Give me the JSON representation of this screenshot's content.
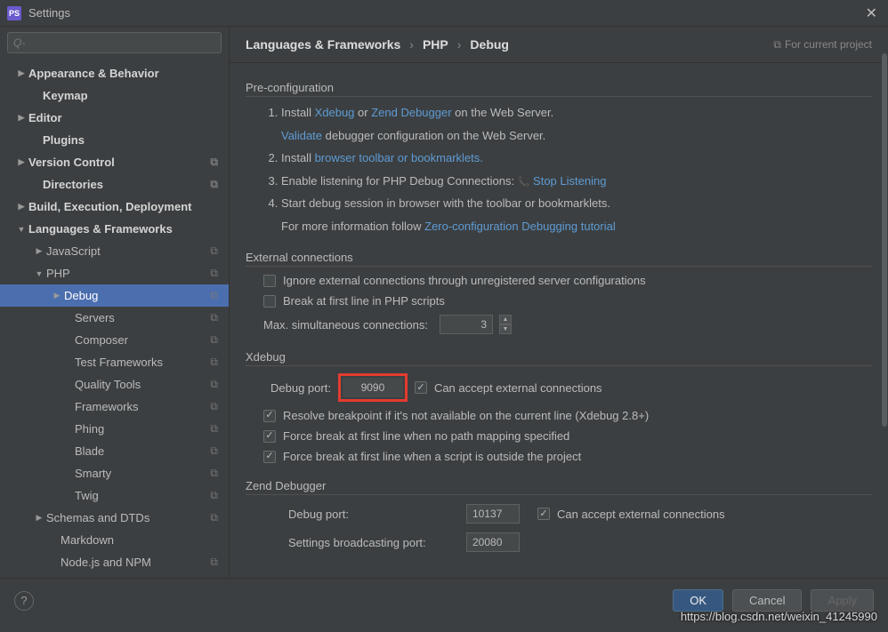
{
  "window": {
    "title": "Settings"
  },
  "search": {
    "placeholder": "Q-"
  },
  "tree": [
    {
      "label": "Appearance & Behavior",
      "bold": true,
      "arrow": "▶",
      "indent": 18
    },
    {
      "label": "Keymap",
      "bold": true,
      "indent": 34
    },
    {
      "label": "Editor",
      "bold": true,
      "arrow": "▶",
      "indent": 18
    },
    {
      "label": "Plugins",
      "bold": true,
      "indent": 34
    },
    {
      "label": "Version Control",
      "bold": true,
      "arrow": "▶",
      "indent": 18,
      "copy": true
    },
    {
      "label": "Directories",
      "bold": true,
      "indent": 34,
      "copy": true
    },
    {
      "label": "Build, Execution, Deployment",
      "bold": true,
      "arrow": "▶",
      "indent": 18
    },
    {
      "label": "Languages & Frameworks",
      "bold": true,
      "arrow": "▼",
      "indent": 18
    },
    {
      "label": "JavaScript",
      "arrow": "▶",
      "indent": 38,
      "copy": true
    },
    {
      "label": "PHP",
      "arrow": "▼",
      "indent": 38,
      "copy": true
    },
    {
      "label": "Debug",
      "arrow": "▶",
      "indent": 58,
      "copy": true,
      "selected": true
    },
    {
      "label": "Servers",
      "indent": 70,
      "copy": true
    },
    {
      "label": "Composer",
      "indent": 70,
      "copy": true
    },
    {
      "label": "Test Frameworks",
      "indent": 70,
      "copy": true
    },
    {
      "label": "Quality Tools",
      "indent": 70,
      "copy": true
    },
    {
      "label": "Frameworks",
      "indent": 70,
      "copy": true
    },
    {
      "label": "Phing",
      "indent": 70,
      "copy": true
    },
    {
      "label": "Blade",
      "indent": 70,
      "copy": true
    },
    {
      "label": "Smarty",
      "indent": 70,
      "copy": true
    },
    {
      "label": "Twig",
      "indent": 70,
      "copy": true
    },
    {
      "label": "Schemas and DTDs",
      "arrow": "▶",
      "indent": 38,
      "copy": true
    },
    {
      "label": "Markdown",
      "indent": 54
    },
    {
      "label": "Node.js and NPM",
      "indent": 54,
      "copy": true
    }
  ],
  "breadcrumb": {
    "a": "Languages & Frameworks",
    "b": "PHP",
    "c": "Debug",
    "proj": "For current project"
  },
  "preconfig": {
    "title": "Pre-configuration",
    "step1a": "Install ",
    "xdebug": "Xdebug",
    "or": " or ",
    "zend": "Zend Debugger",
    "step1b": " on the Web Server.",
    "validate": "Validate",
    "validateb": " debugger configuration on the Web Server.",
    "step2a": "Install ",
    "bookmarklets": "browser toolbar or bookmarklets.",
    "step3a": "Enable listening for PHP Debug Connections: ",
    "stop": "Stop Listening",
    "step4a": "Start debug session in browser with the toolbar or bookmarklets.",
    "step4b": "For more information follow ",
    "tutorial": "Zero-configuration Debugging tutorial"
  },
  "external": {
    "title": "External connections",
    "ignore": "Ignore external connections through unregistered server configurations",
    "break": "Break at first line in PHP scripts",
    "maxlabel": "Max. simultaneous connections:",
    "max": "3"
  },
  "xdebug": {
    "title": "Xdebug",
    "portlabel": "Debug port:",
    "port": "9090",
    "accept": "Can accept external connections",
    "resolve": "Resolve breakpoint if it's not available on the current line (Xdebug 2.8+)",
    "force1": "Force break at first line when no path mapping specified",
    "force2": "Force break at first line when a script is outside the project"
  },
  "zendd": {
    "title": "Zend Debugger",
    "portlabel": "Debug port:",
    "port": "10137",
    "accept": "Can accept external connections",
    "bcastlabel": "Settings broadcasting port:",
    "bcast": "20080"
  },
  "buttons": {
    "ok": "OK",
    "cancel": "Cancel",
    "apply": "Apply"
  },
  "watermark": "https://blog.csdn.net/weixin_41245990"
}
